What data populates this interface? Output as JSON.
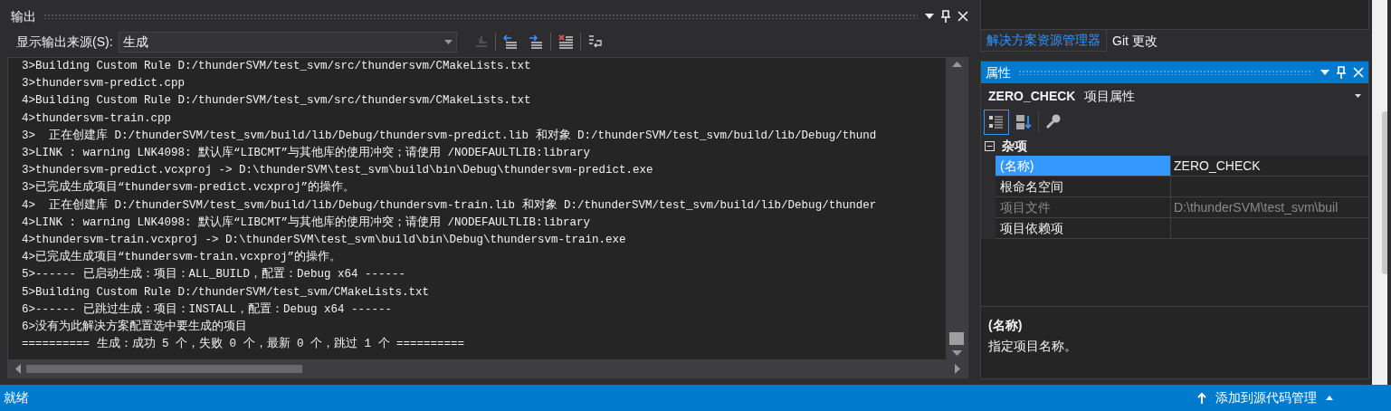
{
  "output_panel": {
    "title": "输出",
    "source_label": "显示输出来源(S):",
    "source_value": "生成",
    "toolbar": [
      {
        "kind": "goto",
        "disabled": true
      },
      {
        "kind": "prev",
        "disabled": false
      },
      {
        "kind": "next",
        "disabled": false
      },
      {
        "kind": "clear",
        "disabled": false
      },
      {
        "kind": "wrap",
        "disabled": false
      }
    ],
    "lines": [
      "3>Building Custom Rule D:/thunderSVM/test_svm/src/thundersvm/CMakeLists.txt",
      "3>thundersvm-predict.cpp",
      "4>Building Custom Rule D:/thunderSVM/test_svm/src/thundersvm/CMakeLists.txt",
      "4>thundersvm-train.cpp",
      "3>  正在创建库 D:/thunderSVM/test_svm/build/lib/Debug/thundersvm-predict.lib 和对象 D:/thunderSVM/test_svm/build/lib/Debug/thund",
      "3>LINK : warning LNK4098: 默认库“LIBCMT”与其他库的使用冲突；请使用 /NODEFAULTLIB:library",
      "3>thundersvm-predict.vcxproj -> D:\\thunderSVM\\test_svm\\build\\bin\\Debug\\thundersvm-predict.exe",
      "3>已完成生成项目“thundersvm-predict.vcxproj”的操作。",
      "4>  正在创建库 D:/thunderSVM/test_svm/build/lib/Debug/thundersvm-train.lib 和对象 D:/thunderSVM/test_svm/build/lib/Debug/thunder",
      "4>LINK : warning LNK4098: 默认库“LIBCMT”与其他库的使用冲突；请使用 /NODEFAULTLIB:library",
      "4>thundersvm-train.vcxproj -> D:\\thunderSVM\\test_svm\\build\\bin\\Debug\\thundersvm-train.exe",
      "4>已完成生成项目“thundersvm-train.vcxproj”的操作。",
      "5>------ 已启动生成：项目：ALL_BUILD，配置：Debug x64 ------",
      "5>Building Custom Rule D:/thunderSVM/test_svm/CMakeLists.txt",
      "6>------ 已跳过生成：项目：INSTALL，配置：Debug x64 ------",
      "6>没有为此解决方案配置选中要生成的项目",
      "========== 生成：成功 5 个，失败 0 个，最新 0 个，跳过 1 个 =========="
    ]
  },
  "side_tabs": [
    {
      "label": "解决方案资源管理器",
      "selected": true
    },
    {
      "label": "Git 更改",
      "selected": false
    }
  ],
  "properties": {
    "title": "属性",
    "object_name": "ZERO_CHECK",
    "object_type": "项目属性",
    "toolbar": [
      {
        "kind": "categorized",
        "selected": true
      },
      {
        "kind": "alphabetical",
        "selected": false
      },
      {
        "kind": "property_pages",
        "selected": false
      }
    ],
    "category": {
      "label": "杂项",
      "expanded": true
    },
    "rows": [
      {
        "name": "(名称)",
        "value": "ZERO_CHECK",
        "selected": true,
        "disabled": false
      },
      {
        "name": "根命名空间",
        "selected": false,
        "disabled": false
      },
      {
        "name": "项目文件",
        "value": "D:\\thunderSVM\\test_svm\\buil",
        "selected": false,
        "disabled": true
      },
      {
        "name": "项目依赖项",
        "selected": false,
        "disabled": false
      }
    ],
    "description": {
      "title": "(名称)",
      "text": "指定项目名称。"
    }
  },
  "status_bar": {
    "left": "就绪",
    "source_control": "添加到源代码管理"
  }
}
